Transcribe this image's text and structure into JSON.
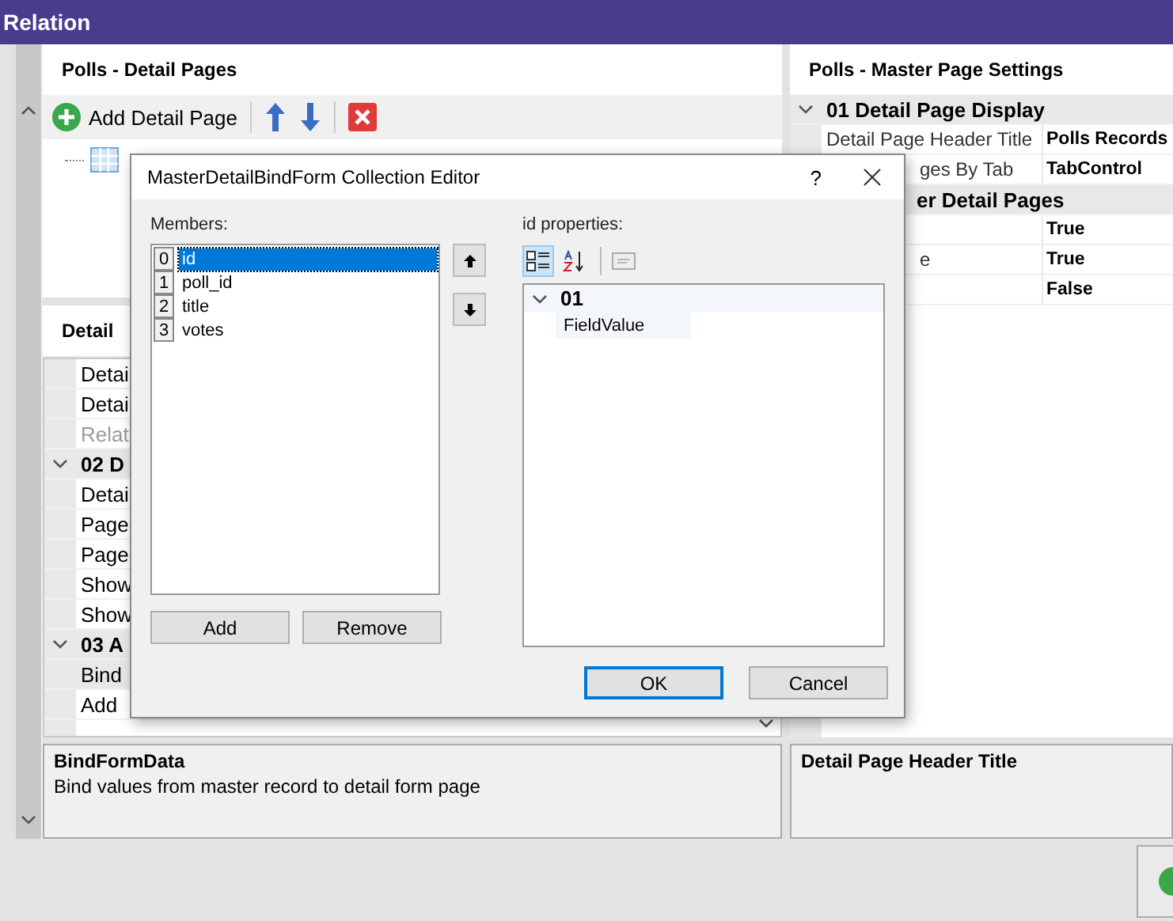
{
  "window": {
    "title": "Relation"
  },
  "detail_pages": {
    "title": "Polls - Detail Pages",
    "add_label": "Add Detail Page"
  },
  "detail_settings": {
    "title": "Detail",
    "rows": [
      {
        "kind": "item",
        "label": "Detai",
        "disabled": false,
        "selected": false
      },
      {
        "kind": "item",
        "label": "Detai",
        "disabled": false,
        "selected": false
      },
      {
        "kind": "item",
        "label": "Relat",
        "disabled": true,
        "selected": false
      },
      {
        "kind": "group",
        "label": "02 D",
        "expanded": true
      },
      {
        "kind": "item",
        "label": "Detai",
        "disabled": false,
        "selected": false
      },
      {
        "kind": "item",
        "label": "Page",
        "disabled": false,
        "selected": false
      },
      {
        "kind": "item",
        "label": "Page",
        "disabled": false,
        "selected": false
      },
      {
        "kind": "item",
        "label": "Show",
        "disabled": false,
        "selected": false
      },
      {
        "kind": "item",
        "label": "Show",
        "disabled": false,
        "selected": false
      },
      {
        "kind": "group",
        "label": "03 A",
        "expanded": true
      },
      {
        "kind": "item",
        "label": "Bind",
        "disabled": false,
        "selected": true
      },
      {
        "kind": "item",
        "label": "Add",
        "disabled": false,
        "selected": false
      }
    ],
    "description": {
      "title": "BindFormData",
      "text": "Bind values from master record to detail form page"
    }
  },
  "master_settings": {
    "title": "Polls - Master Page Settings",
    "rows": [
      {
        "kind": "group",
        "label": "01 Detail Page Display",
        "expanded": true
      },
      {
        "kind": "item",
        "label": "Detail Page Header Title",
        "value": "Polls Records"
      },
      {
        "kind": "item",
        "label": "ges By Tab",
        "value": "TabControl"
      },
      {
        "kind": "group",
        "label": "er Detail Pages"
      },
      {
        "kind": "item",
        "value": "True"
      },
      {
        "kind": "item",
        "label": "e",
        "value": "True"
      },
      {
        "kind": "item",
        "value": "False"
      }
    ],
    "description": {
      "title": "Detail Page Header Title"
    }
  },
  "dialog": {
    "title": "MasterDetailBindForm Collection Editor",
    "help": "?",
    "members_label": "Members:",
    "members": [
      {
        "index": "0",
        "name": "id",
        "selected": true
      },
      {
        "index": "1",
        "name": "poll_id",
        "selected": false
      },
      {
        "index": "2",
        "name": "title",
        "selected": false
      },
      {
        "index": "3",
        "name": "votes",
        "selected": false
      }
    ],
    "add": "Add",
    "remove": "Remove",
    "properties_label": "id properties:",
    "views": [
      {
        "kind": "categorized",
        "selected": true
      },
      {
        "kind": "alphabetical",
        "selected": false
      }
    ],
    "properties": [
      {
        "kind": "group",
        "label": "01",
        "expanded": true
      },
      {
        "kind": "item",
        "label": "FieldValue"
      }
    ],
    "ok": "OK",
    "cancel": "Cancel"
  }
}
